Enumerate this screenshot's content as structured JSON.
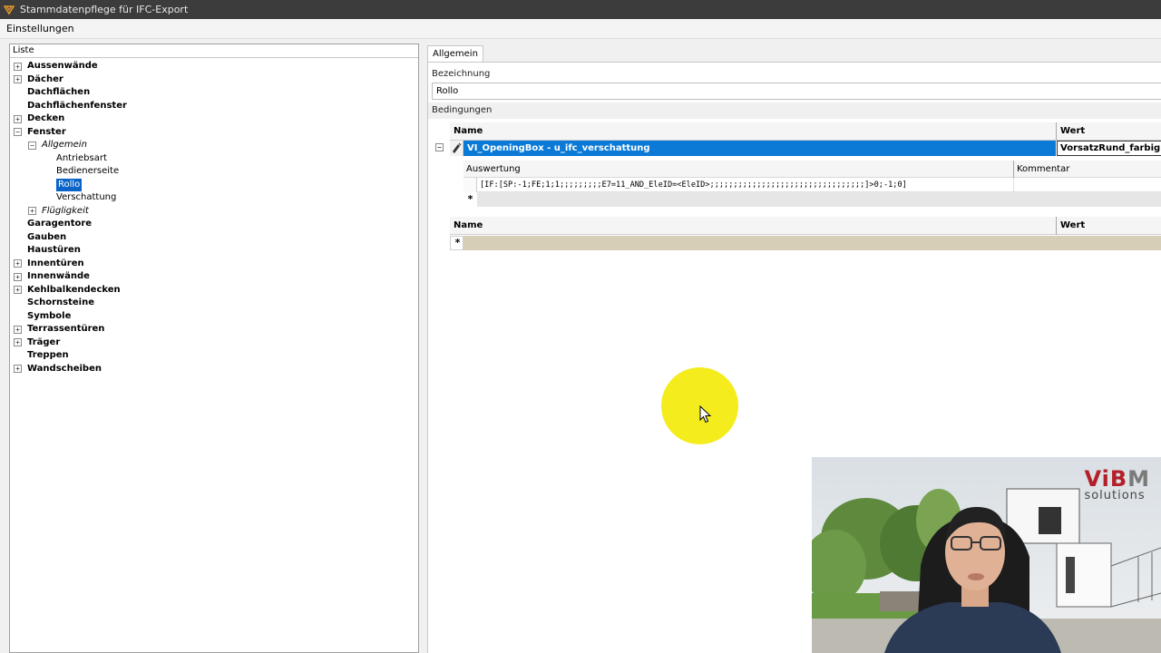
{
  "window": {
    "title": "Stammdatenpflege für IFC-Export"
  },
  "menu": {
    "items": [
      "Einstellungen"
    ]
  },
  "left_panel": {
    "header": "Liste",
    "tree": [
      {
        "label": "Aussenwände",
        "level": 0,
        "expander": "plus",
        "style": "bold"
      },
      {
        "label": "Dächer",
        "level": 0,
        "expander": "plus",
        "style": "bold"
      },
      {
        "label": "Dachflächen",
        "level": 0,
        "expander": "none",
        "style": "bold"
      },
      {
        "label": "Dachflächenfenster",
        "level": 0,
        "expander": "none",
        "style": "bold"
      },
      {
        "label": "Decken",
        "level": 0,
        "expander": "plus",
        "style": "bold"
      },
      {
        "label": "Fenster",
        "level": 0,
        "expander": "minus",
        "style": "bold"
      },
      {
        "label": "Allgemein",
        "level": 1,
        "expander": "minus",
        "style": "italic"
      },
      {
        "label": "Antriebsart",
        "level": 2,
        "expander": "none",
        "style": "normal"
      },
      {
        "label": "Bedienerseite",
        "level": 2,
        "expander": "none",
        "style": "normal"
      },
      {
        "label": "Rollo",
        "level": 2,
        "expander": "none",
        "style": "normal",
        "selected": true
      },
      {
        "label": "Verschattung",
        "level": 2,
        "expander": "none",
        "style": "normal"
      },
      {
        "label": "Flügligkeit",
        "level": 1,
        "expander": "plus",
        "style": "italic"
      },
      {
        "label": "Garagentore",
        "level": 0,
        "expander": "none",
        "style": "bold"
      },
      {
        "label": "Gauben",
        "level": 0,
        "expander": "none",
        "style": "bold"
      },
      {
        "label": "Haustüren",
        "level": 0,
        "expander": "none",
        "style": "bold"
      },
      {
        "label": "Innentüren",
        "level": 0,
        "expander": "plus",
        "style": "bold"
      },
      {
        "label": "Innenwände",
        "level": 0,
        "expander": "plus",
        "style": "bold"
      },
      {
        "label": "Kehlbalkendecken",
        "level": 0,
        "expander": "plus",
        "style": "bold"
      },
      {
        "label": "Schornsteine",
        "level": 0,
        "expander": "none",
        "style": "bold"
      },
      {
        "label": "Symbole",
        "level": 0,
        "expander": "none",
        "style": "bold"
      },
      {
        "label": "Terrassentüren",
        "level": 0,
        "expander": "plus",
        "style": "bold"
      },
      {
        "label": "Träger",
        "level": 0,
        "expander": "plus",
        "style": "bold"
      },
      {
        "label": "Treppen",
        "level": 0,
        "expander": "none",
        "style": "bold"
      },
      {
        "label": "Wandscheiben",
        "level": 0,
        "expander": "plus",
        "style": "bold"
      }
    ]
  },
  "right_panel": {
    "tab": "Allgemein",
    "bezeichnung_label": "Bezeichnung",
    "bezeichnung_value": "Rollo",
    "bedingungen_label": "Bedingungen",
    "grid": {
      "col_name": "Name",
      "col_wert": "Wert",
      "row_name": "VI_OpeningBox - u_ifc_verschattung",
      "row_wert": "VorsatzRund_farbig",
      "sub": {
        "col_auswertung": "Auswertung",
        "col_kommentar": "Kommentar",
        "auswertung_value": "[IF:[SP:-1;FE;1;1;;;;;;;;;E7=11_AND_EleID=<EleID>;;;;;;;;;;;;;;;;;;;;;;;;;;;;;;;;;]>0;-1;0]",
        "new_row_marker": "*"
      },
      "grid2_col_name": "Name",
      "grid2_col_wert": "Wert",
      "new_row_marker": "*"
    }
  },
  "overlay": {
    "logo_main_a": "ViB",
    "logo_main_b": "M",
    "logo_sub": "solutions",
    "highlight_color": "#f5ec1e"
  },
  "colors": {
    "selection": "#0a7ad6",
    "title_bar": "#3c3c3c",
    "new_row": "#d7ceb8"
  }
}
